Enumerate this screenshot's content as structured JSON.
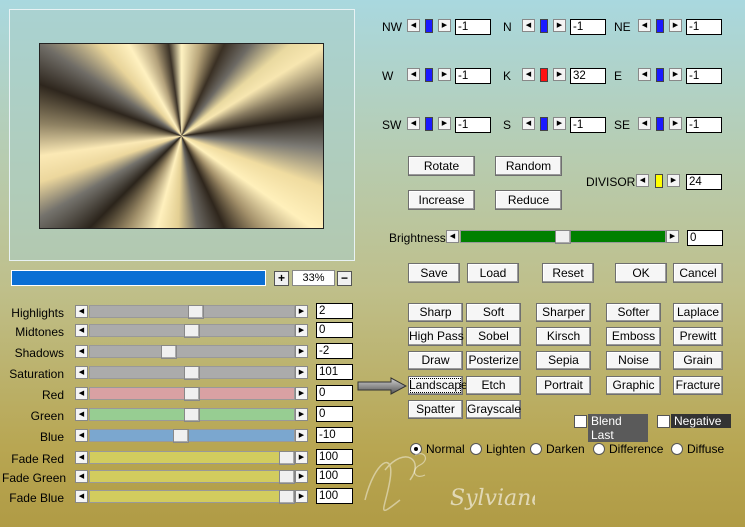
{
  "preview": {
    "zoom_value": "33%",
    "progress_fraction": 1.0,
    "zoom_in_label": "+",
    "zoom_out_label": "−"
  },
  "sliders": [
    {
      "id": "highlights",
      "label": "Highlights",
      "value": "2",
      "fraction": 0.52,
      "track": "#ababab"
    },
    {
      "id": "midtones",
      "label": "Midtones",
      "value": "0",
      "fraction": 0.5,
      "track": "#ababab"
    },
    {
      "id": "shadows",
      "label": "Shadows",
      "value": "-2",
      "fraction": 0.38,
      "track": "#ababab"
    },
    {
      "id": "saturation",
      "label": "Saturation",
      "value": "101",
      "fraction": 0.5,
      "track": "#ababab"
    },
    {
      "id": "red",
      "label": "Red",
      "value": "0",
      "fraction": 0.5,
      "track": "#d9a1a3"
    },
    {
      "id": "green",
      "label": "Green",
      "value": "0",
      "fraction": 0.5,
      "track": "#97cd92"
    },
    {
      "id": "blue",
      "label": "Blue",
      "value": "-10",
      "fraction": 0.44,
      "track": "#7ba7cf"
    },
    {
      "id": "fade_red",
      "label": "Fade Red",
      "value": "100",
      "fraction": 1.0,
      "track": "#d2cc5e"
    },
    {
      "id": "fade_green",
      "label": "Fade Green",
      "value": "100",
      "fraction": 1.0,
      "track": "#d2cc5e"
    },
    {
      "id": "fade_blue",
      "label": "Fade Blue",
      "value": "100",
      "fraction": 1.0,
      "track": "#d2cc5e"
    }
  ],
  "kernel": [
    {
      "id": "nw",
      "label": "NW",
      "value": "-1",
      "knob": "#1a1aff"
    },
    {
      "id": "n",
      "label": "N",
      "value": "-1",
      "knob": "#1a1aff"
    },
    {
      "id": "ne",
      "label": "NE",
      "value": "-1",
      "knob": "#1a1aff"
    },
    {
      "id": "w",
      "label": "W",
      "value": "-1",
      "knob": "#1a1aff"
    },
    {
      "id": "k",
      "label": "K",
      "value": "32",
      "knob": "#ff1010"
    },
    {
      "id": "e",
      "label": "E",
      "value": "-1",
      "knob": "#1a1aff"
    },
    {
      "id": "sw",
      "label": "SW",
      "value": "-1",
      "knob": "#1a1aff"
    },
    {
      "id": "s",
      "label": "S",
      "value": "-1",
      "knob": "#1a1aff"
    },
    {
      "id": "se",
      "label": "SE",
      "value": "-1",
      "knob": "#1a1aff"
    }
  ],
  "divisor": {
    "label": "DIVISOR",
    "value": "24",
    "knob": "#ffff00"
  },
  "kernel_buttons": {
    "rotate": "Rotate",
    "random": "Random",
    "increase": "Increase",
    "reduce": "Reduce"
  },
  "brightness": {
    "label": "Brightness",
    "value": "0",
    "fraction": 0.5,
    "track": "#008000"
  },
  "actions": {
    "save": "Save",
    "load": "Load",
    "reset": "Reset",
    "ok": "OK",
    "cancel": "Cancel"
  },
  "presets": [
    [
      "Sharp",
      "Soft",
      "Sharper",
      "Softer",
      "Laplace"
    ],
    [
      "High Pass",
      "Sobel",
      "Kirsch",
      "Emboss",
      "Prewitt"
    ],
    [
      "Draw",
      "Posterize",
      "Sepia",
      "Noise",
      "Grain"
    ],
    [
      "Landscape",
      "Etch",
      "Portrait",
      "Graphic",
      "Fracture"
    ],
    [
      "Spatter",
      "Grayscale"
    ]
  ],
  "options": {
    "blend_last": "Blend Last",
    "negative": "Negative"
  },
  "blend_modes": [
    "Normal",
    "Lighten",
    "Darken",
    "Difference",
    "Diffuse"
  ],
  "selected_blend": "Normal",
  "watermark": "Sylviane"
}
